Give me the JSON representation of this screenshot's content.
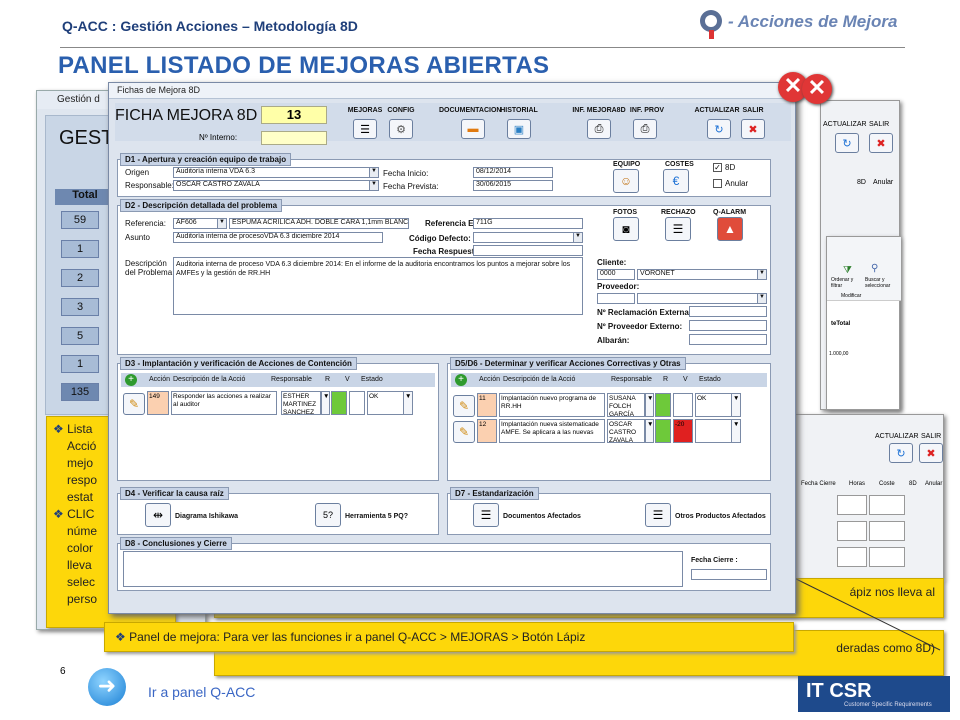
{
  "header": {
    "app_title": "Q-ACC : Gestión Acciones – Metodología 8D",
    "logo_text": "- Acciones de Mejora"
  },
  "page_title": "PANEL LISTADO DE MEJORAS ABIERTAS",
  "back_window": {
    "title": "Gestión d",
    "heading": "GEST",
    "total_label": "Total",
    "counts": [
      "59",
      "1",
      "2",
      "3",
      "5",
      "1",
      "135"
    ]
  },
  "left_notes": {
    "line1": "Lista",
    "line2": "Acció",
    "line3": "mejo",
    "line4": "respo",
    "line5": "estat",
    "line6": "CLIC",
    "line7": "núme",
    "line8": "color",
    "line9": "lleva",
    "line10": "selec",
    "line11": "perso"
  },
  "right_window_top": {
    "actualizar": "ACTUALIZAR",
    "salir": "SALIR",
    "col_8d": "8D",
    "col_anular": "Anular",
    "excel_label1": "Ordenar y filtrar",
    "excel_label2": "Buscar y seleccionar",
    "excel_label3": "Modificar",
    "excel_cell": "teTotal",
    "excel_value": "1.000,00"
  },
  "right_window_bottom": {
    "actualizar": "ACTUALIZAR",
    "salir": "SALIR",
    "fecha_cierre": "Fecha Cierre",
    "horas": "Horas",
    "coste": "Coste",
    "col_8d": "8D",
    "col_anular": "Anular"
  },
  "partial_notes": {
    "right_note": "ápiz nos lleva al",
    "bottom_note": "deradas como 8D)"
  },
  "main_window": {
    "title": "Fichas de Mejora 8D",
    "ficha_title": "FICHA MEJORA 8D",
    "ficha_number": "13",
    "ni_label": "Nº Interno:",
    "toolbar": {
      "mejoras": "MEJORAS",
      "config": "CONFIG",
      "documentacion": "DOCUMENTACION",
      "historial": "HISTORIAL",
      "inf_mejora": "INF. MEJORA8D",
      "inf_prov": "INF. PROV",
      "actualizar": "ACTUALIZAR",
      "salir": "SALIR"
    },
    "d1": {
      "title": "D1 - Apertura y creación equipo de trabajo",
      "origen_label": "Origen",
      "origen_value": "Auditoría interna VDA 6.3",
      "responsable_label": "Responsable:",
      "responsable_value": "OSCAR  CASTRO ZAVALA",
      "fecha_inicio_label": "Fecha Inicio:",
      "fecha_inicio_value": "08/12/2014",
      "fecha_prevista_label": "Fecha Prevista:",
      "fecha_prevista_value": "30/06/2015",
      "equipo_label": "EQUIPO",
      "costes_label": "COSTES",
      "cb_8d": "8D",
      "cb_anular": "Anular"
    },
    "d2": {
      "title": "D2 - Descripción detallada del problema",
      "referencia_label": "Referencia:",
      "referencia_value": "AF606",
      "referencia_desc": "ESPUMA ACRÍLICA ADH. DOBLE CARA 1,1mm BLANCO/GR",
      "ref_ext_label": "Referencia Ext:",
      "ref_ext_value": "711G",
      "asunto_label": "Asunto",
      "asunto_value": "Auditoría interna de procesoVDA 6.3 diciembre 2014",
      "codigo_label": "Código Defecto:",
      "fecha_resp_label": "Fecha Respuesta:",
      "desc_label1": "Descripción",
      "desc_label2": "del Problema",
      "desc_value": "Auditoria interna de proceso VDA 6.3 diciembre 2014: En el informe de la auditoria encontramos los puntos a mejorar sobre los AMFEs y la gestión de RR.HH",
      "fotos_label": "FOTOS",
      "rechazo_label": "RECHAZO",
      "qalarm_label": "Q-ALARM",
      "cliente_label": "Cliente:",
      "cliente_code": "0000",
      "cliente_name": "VORONET",
      "proveedor_label": "Proveedor:",
      "recl_ext_label": "Nº Reclamación Externa:",
      "prov_ext_label": "Nº Proveedor Externo:",
      "albaran_label": "Albarán:"
    },
    "d3": {
      "title": "D3 - Implantación y verificación de Acciones de Contención",
      "col_accion": "Acción",
      "col_desc": "Descripción de la Acció",
      "col_resp": "Responsable",
      "col_r": "R",
      "col_v": "V",
      "col_estado": "Estado",
      "row_id": "149",
      "row_desc": "Responder las acciones a realizar al auditor",
      "row_resp": "ESTHER MARTINEZ SANCHEZ",
      "row_estado": "OK"
    },
    "d56": {
      "title": "D5/D6 - Determinar y verificar Acciones Correctivas y Otras",
      "col_accion": "Acción",
      "col_desc": "Descripción de la Acció",
      "col_resp": "Responsable",
      "col_r": "R",
      "col_v": "V",
      "col_estado": "Estado",
      "row1_id": "11",
      "row1_desc": "Implantación nuevo programa de RR.HH",
      "row1_resp": "SUSANA FOLCH GARCÍA",
      "row1_estado": "OK",
      "row2_id": "12",
      "row2_desc": "Implantación nueva sistematicade AMFE. Se aplicara a las nuevas",
      "row2_resp": "OSCAR CASTRO ZAVALA",
      "row2_v": "-20"
    },
    "d4": {
      "title": "D4 - Verificar la causa raíz",
      "ishikawa": "Diagrama Ishikawa",
      "five_pq": "Herramienta 5 PQ?",
      "five_pq_icon": "5?"
    },
    "d7": {
      "title": "D7 - Estandarización",
      "docs": "Documentos Afectados",
      "prods": "Otros Productos Afectados"
    },
    "d8": {
      "title": "D8 - Conclusiones y Cierre",
      "fecha_cierre_label": "Fecha Cierre :"
    }
  },
  "bottom_note": "Panel de mejora: Para ver las funciones ir a panel Q-ACC > MEJORAS > Botón Lápiz",
  "page_number": "6",
  "bottom_link": "Ir a panel Q-ACC",
  "footer_logo": "IT CSR",
  "footer_logo_sub": "Customer Specific Requirements",
  "colors": {
    "title_blue": "#2a5fae",
    "note_yellow": "#fdd70a",
    "close_red": "#e03636"
  }
}
